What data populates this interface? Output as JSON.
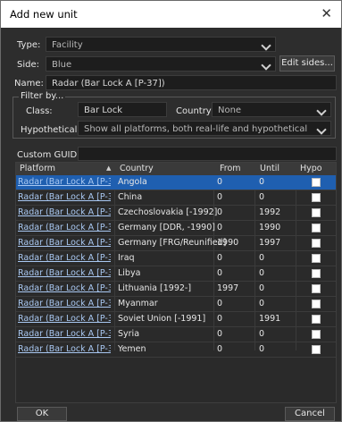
{
  "window": {
    "title": "Add new unit",
    "close_glyph": "✕"
  },
  "form": {
    "type_label": "Type:",
    "type_value": "Facility",
    "side_label": "Side:",
    "side_value": "Blue",
    "edit_sides_label": "Edit sides...",
    "name_label": "Name:",
    "name_value": "Radar (Bar Lock A [P-37])"
  },
  "filter": {
    "group_title": "Filter by...",
    "class_label": "Class:",
    "class_value": "Bar Lock",
    "country_label": "Country:",
    "country_value": "None",
    "hypothetical_label": "Hypothetical:",
    "hypothetical_value": "Show all platforms, both real-life and hypothetical"
  },
  "guid": {
    "label": "Custom GUID:",
    "value": ""
  },
  "table": {
    "headers": {
      "platform": "Platform",
      "country": "Country",
      "from": "From",
      "until": "Until",
      "hypo": "Hypo"
    },
    "sort_icon": "▲",
    "selected_index": 0,
    "rows": [
      {
        "platform": "Radar (Bar Lock A [P-3...",
        "country": "Angola",
        "from": "0",
        "until": "0",
        "hypo": false
      },
      {
        "platform": "Radar (Bar Lock A [P-3...",
        "country": "China",
        "from": "0",
        "until": "0",
        "hypo": false
      },
      {
        "platform": "Radar (Bar Lock A [P-3...",
        "country": "Czechoslovakia [-1992]",
        "from": "0",
        "until": "1992",
        "hypo": false
      },
      {
        "platform": "Radar (Bar Lock A [P-3...",
        "country": "Germany [DDR, -1990]",
        "from": "0",
        "until": "1990",
        "hypo": false
      },
      {
        "platform": "Radar (Bar Lock A [P-3...",
        "country": "Germany [FRG/Reunified]",
        "from": "1990",
        "until": "1997",
        "hypo": false
      },
      {
        "platform": "Radar (Bar Lock A [P-3...",
        "country": "Iraq",
        "from": "0",
        "until": "0",
        "hypo": false
      },
      {
        "platform": "Radar (Bar Lock A [P-3...",
        "country": "Libya",
        "from": "0",
        "until": "0",
        "hypo": false
      },
      {
        "platform": "Radar (Bar Lock A [P-3...",
        "country": "Lithuania [1992-]",
        "from": "1997",
        "until": "0",
        "hypo": false
      },
      {
        "platform": "Radar (Bar Lock A [P-3...",
        "country": "Myanmar",
        "from": "0",
        "until": "0",
        "hypo": false
      },
      {
        "platform": "Radar (Bar Lock A [P-3...",
        "country": "Soviet Union [-1991]",
        "from": "0",
        "until": "1991",
        "hypo": false
      },
      {
        "platform": "Radar (Bar Lock A [P-3...",
        "country": "Syria",
        "from": "0",
        "until": "0",
        "hypo": false
      },
      {
        "platform": "Radar (Bar Lock A [P-3...",
        "country": "Yemen",
        "from": "0",
        "until": "0",
        "hypo": false
      }
    ]
  },
  "footer": {
    "ok_label": "OK",
    "cancel_label": "Cancel"
  }
}
